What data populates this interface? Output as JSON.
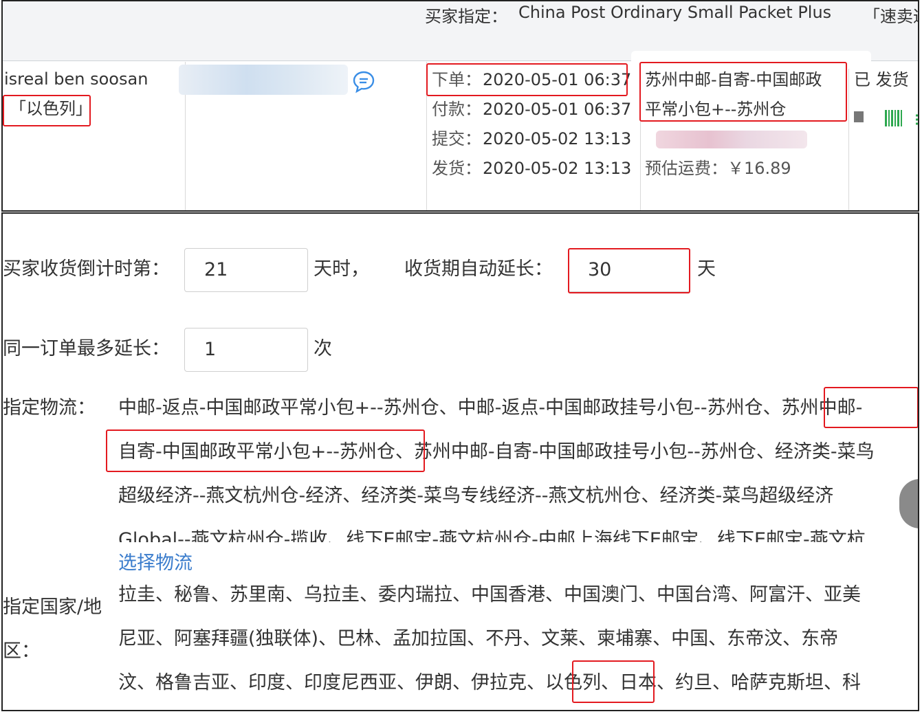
{
  "order_header": {
    "buyer_specified_label": "买家指定：",
    "buyer_specified_value": "China Post Ordinary Small Packet Plus",
    "right_partial": "「速卖通"
  },
  "order": {
    "buyer_name": "isreal ben soosan",
    "buyer_country": "「以色列」",
    "times": [
      {
        "label": "下单：",
        "value": "2020-05-01 06:37"
      },
      {
        "label": "付款：",
        "value": "2020-05-01 06:37"
      },
      {
        "label": "提交：",
        "value": "2020-05-02 13:13"
      },
      {
        "label": "发货：",
        "value": "2020-05-02 13:13"
      }
    ],
    "logistics_line1": "苏州中邮-自寄-中国邮政",
    "logistics_line2": "平常小包+--苏州仓",
    "estimated_freight": "预估运费：￥16.89",
    "status_partial": "已 发货"
  },
  "settings": {
    "countdown_label": "买家收货倒计时第：",
    "countdown_value": "21",
    "countdown_suffix": "天时，",
    "auto_extend_label": "收货期自动延长：",
    "auto_extend_value": "30",
    "auto_extend_suffix": "天",
    "max_extend_label": "同一订单最多延长：",
    "max_extend_value": "1",
    "max_extend_suffix": "次",
    "logistics_label": "指定物流：",
    "logistics_lines": [
      "中邮-返点-中国邮政平常小包+--苏州仓、中邮-返点-中国邮政挂号小包--苏州仓、苏州中邮-",
      "自寄-中国邮政平常小包+--苏州仓、苏州中邮-自寄-中国邮政挂号小包--苏州仓、经济类-菜鸟",
      "超级经济--燕文杭州仓-经济、经济类-菜鸟专线经济--燕文杭州仓、经济类-菜鸟超级经济",
      "Global--燕文杭州仓-揽收、线下E邮宝-燕文杭州仓-中邮上海线下E邮宝、线下E邮宝-燕文杭"
    ],
    "select_logistics_link": "选择物流",
    "country_label_line1": "指定国家/地",
    "country_label_line2": "区：",
    "country_lines": [
      "拉圭、秘鲁、苏里南、乌拉圭、委内瑞拉、中国香港、中国澳门、中国台湾、阿富汗、亚美",
      "尼亚、阿塞拜疆(独联体)、巴林、孟加拉国、不丹、文莱、柬埔寨、中国、东帝汶、东帝",
      "汶、格鲁吉亚、印度、印度尼西亚、伊朗、伊拉克、以色列、日本、约旦、哈萨克斯坦、科"
    ]
  },
  "colors": {
    "highlight": "#e3191f",
    "link": "#3a7ccc",
    "chat_icon": "#3a8ee6"
  }
}
